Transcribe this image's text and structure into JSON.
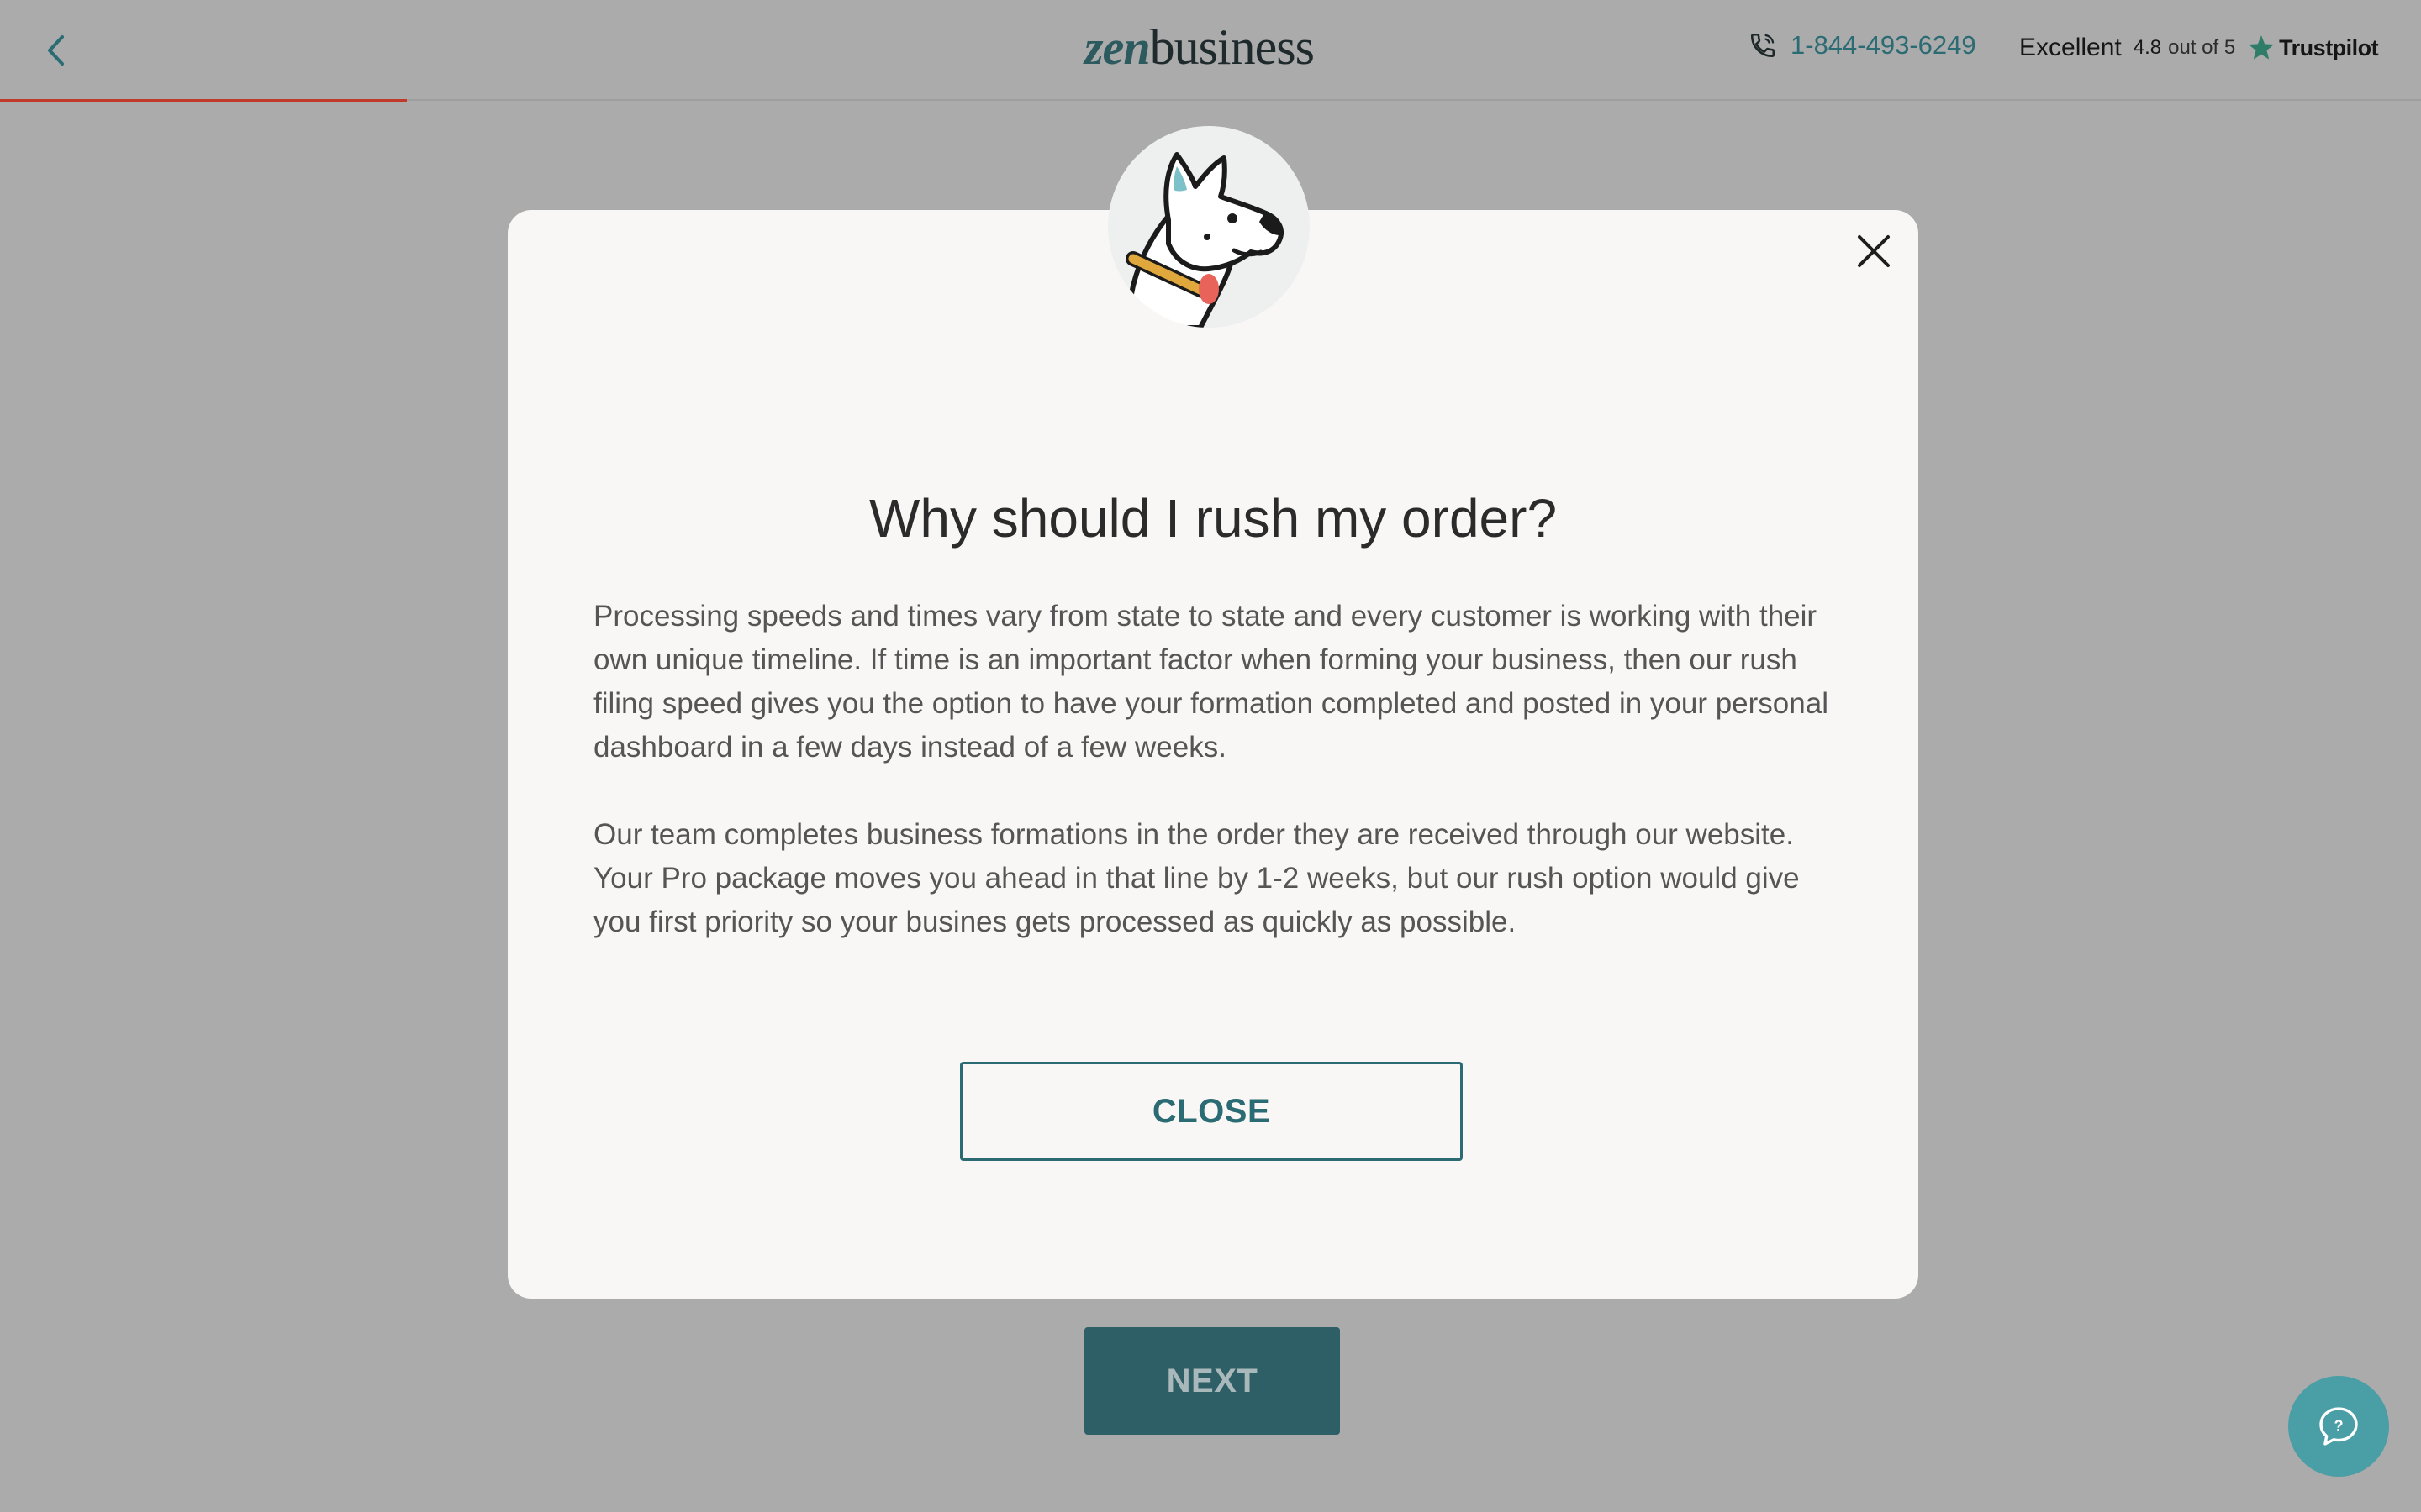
{
  "header": {
    "back_icon": "chevron-left-icon",
    "logo": {
      "part1": "zen",
      "part2": "business"
    },
    "phone": {
      "icon": "phone-icon",
      "number": "1-844-493-6249"
    },
    "rating": {
      "label": "Excellent",
      "score": "4.8",
      "out_of": "out of 5",
      "star_icon": "star-icon",
      "brand": "Trustpilot"
    },
    "progress_fraction": 0.168
  },
  "modal": {
    "avatar_icon": "dog-mascot-icon",
    "close_icon": "close-icon",
    "title": "Why should I rush my order?",
    "paragraphs": [
      "Processing speeds and times vary from state to state and every customer is working with their own unique timeline. If time is an important factor when forming your business, then our rush filing speed gives you the option to have your formation completed and posted in your personal dashboard in a few days instead of a few weeks.",
      "Our team completes business formations in the order they are received through our website. Your Pro package moves you ahead in that line by 1-2 weeks, but our rush option would give you first priority so your busines gets processed as quickly as possible."
    ],
    "close_button": "CLOSE"
  },
  "page": {
    "next_button": "NEXT",
    "help_icon": "help-chat-icon"
  },
  "colors": {
    "overlay_bg": "#ababab",
    "brand_teal": "#2b6b73",
    "progress_red": "#c0392b",
    "trustpilot_green": "#00b67a"
  }
}
